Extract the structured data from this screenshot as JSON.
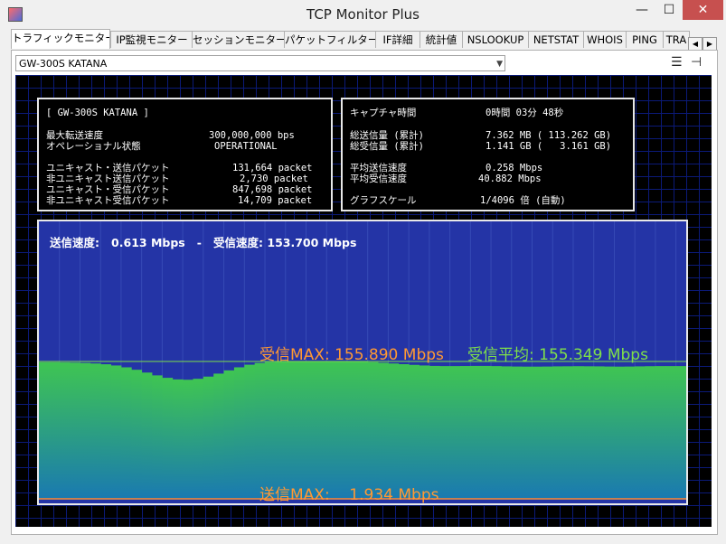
{
  "window": {
    "title": "TCP Monitor Plus",
    "minimize": "—",
    "maximize": "☐",
    "close": "✕"
  },
  "tabs": [
    "トラフィックモニター",
    "IP監視モニター",
    "セッションモニター",
    "パケットフィルター",
    "IF詳細",
    "統計値",
    "NSLOOKUP",
    "NETSTAT",
    "WHOIS",
    "PING",
    "TRA"
  ],
  "adapter": {
    "selected": "GW-300S KATANA"
  },
  "info_left": {
    "name": "[ GW-300S KATANA ]",
    "rows": [
      {
        "label": "最大転送速度",
        "value": "300,000,000 bps"
      },
      {
        "label": "オペレーショナル状態",
        "value": "OPERATIONAL"
      },
      {
        "label": "ユニキャスト・送信パケット",
        "value": "131,664 packet"
      },
      {
        "label": "非ユニキャスト送信パケット",
        "value": "2,730 packet"
      },
      {
        "label": "ユニキャスト・受信パケット",
        "value": "847,698 packet"
      },
      {
        "label": "非ユニキャスト受信パケット",
        "value": "14,709 packet"
      }
    ]
  },
  "info_right": {
    "rows": [
      {
        "label": "キャプチャ時間",
        "value": "0時間 03分 48秒"
      },
      {
        "label": "総送信量 (累計)",
        "value": "7.362 MB ( 113.262 GB)"
      },
      {
        "label": "総受信量 (累計)",
        "value": "1.141 GB (   3.161 GB)"
      },
      {
        "label": "平均送信速度",
        "value": "0.258 Mbps"
      },
      {
        "label": "平均受信速度",
        "value": "40.882 Mbps"
      },
      {
        "label": "グラフスケール",
        "value": "1/4096 倍 (自動)"
      }
    ]
  },
  "graph": {
    "speed_text": "送信速度:   0.613 Mbps   -   受信速度: 153.700 Mbps",
    "recv_max": "受信MAX: 155.890 Mbps",
    "recv_avg": "受信平均: 155.349 Mbps",
    "send_max": "送信MAX:    1.934 Mbps",
    "colors": {
      "recv_max": "#ff9933",
      "recv_avg": "#7ee04a",
      "send_max": "#ff9933",
      "fill_top": "#3fc552",
      "fill_bottom": "#1a7ab0"
    }
  },
  "chart_data": {
    "type": "area",
    "series": [
      {
        "values": [
          155.0,
          155.0,
          154.8,
          154.6,
          154.2,
          153.6,
          152.7,
          151.3,
          149.2,
          146.4,
          143.2,
          140.0,
          137.2,
          135.4,
          135.0,
          136.1,
          138.6,
          142.0,
          145.7,
          149.2,
          152.2,
          154.2,
          155.2,
          155.5,
          155.5,
          155.6,
          155.7,
          155.8,
          155.8,
          155.9,
          155.8,
          155.6,
          155.1,
          154.4,
          153.6,
          152.8,
          152.0,
          151.3,
          150.8,
          150.6,
          150.6,
          150.7,
          150.8,
          150.8,
          150.6,
          150.3,
          150.1,
          150.0,
          150.0,
          150.1,
          150.3,
          150.4,
          150.5,
          150.4,
          150.3,
          150.1,
          150.0,
          150.1,
          150.3,
          150.5,
          150.6,
          150.6,
          150.6
        ]
      }
    ],
    "ylim": [
      0,
      155.89
    ]
  }
}
